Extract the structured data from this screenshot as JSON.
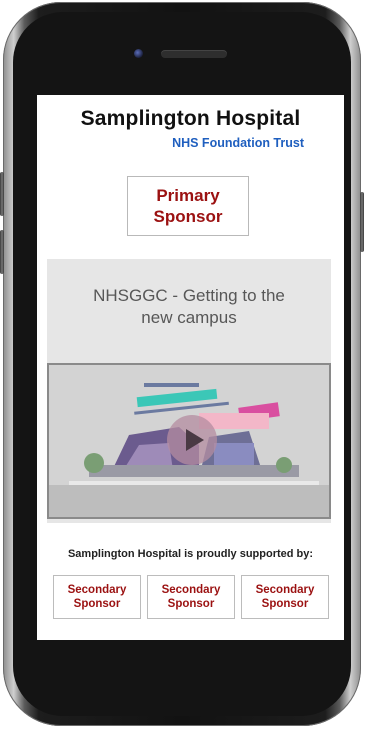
{
  "hospital": {
    "name": "Samplington Hospital",
    "trust": "NHS Foundation Trust"
  },
  "primary_sponsor": {
    "label": "Primary\nSponsor"
  },
  "video": {
    "title": "NHSGGC - Getting to the\nnew campus",
    "play_icon": "play-icon"
  },
  "supported_text": "Samplington Hospital is proudly supported by:",
  "secondary_sponsors": [
    {
      "label": "Secondary\nSponsor"
    },
    {
      "label": "Secondary\nSponsor"
    },
    {
      "label": "Secondary\nSponsor"
    }
  ],
  "colors": {
    "sponsor_text": "#9b1111",
    "trust_text": "#1f5fbf",
    "video_bg": "#e6e6e6"
  }
}
